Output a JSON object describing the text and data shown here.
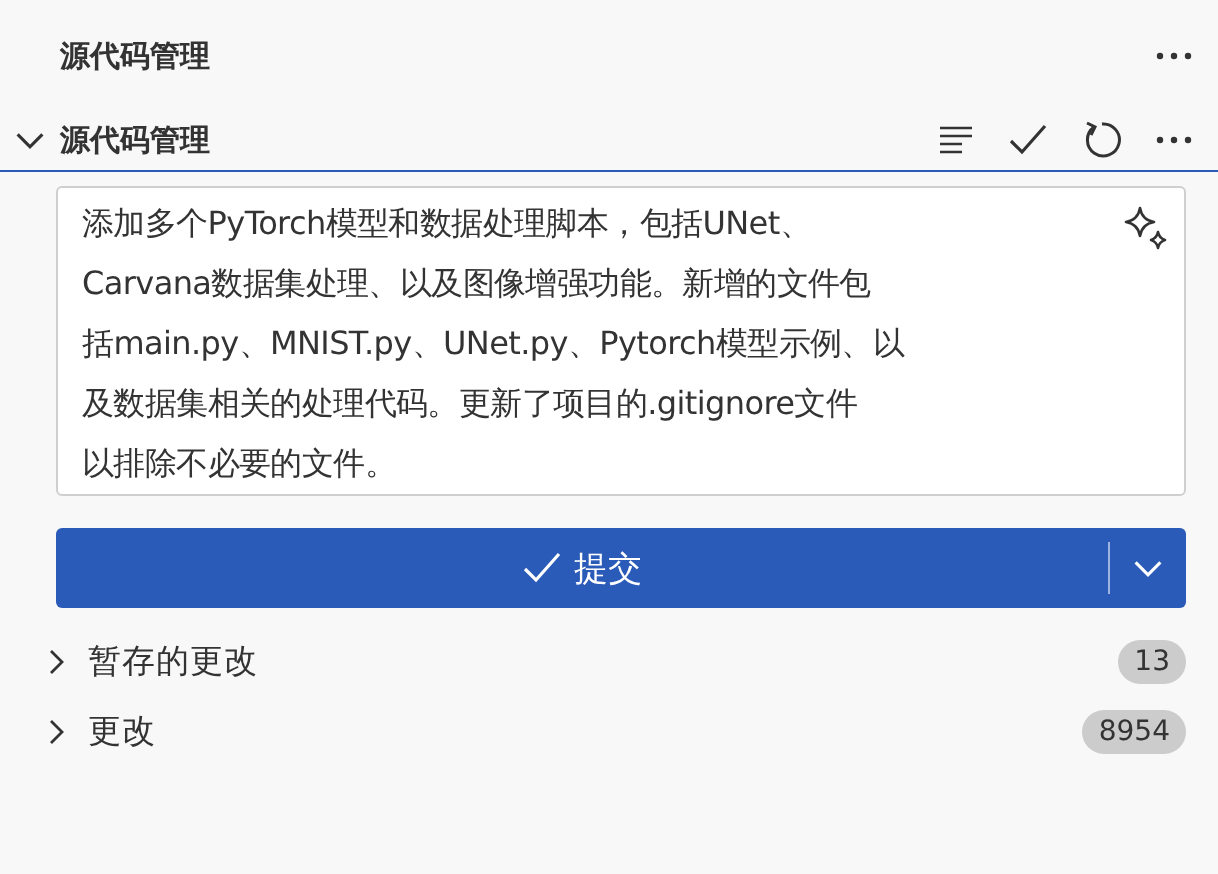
{
  "view_title": "源代码管理",
  "section": {
    "title": "源代码管理",
    "expanded": true
  },
  "commit_message": {
    "lines": [
      "添加多个PyTorch模型和数据处理脚本，包括UNet、",
      "Carvana数据集处理、以及图像增强功能。新增的文件包",
      "括main.py、MNIST.py、UNet.py、Pytorch模型示例、以",
      "及数据集相关的处理代码。更新了项目的.gitignore文件",
      "以排除不必要的文件。"
    ]
  },
  "commit_button": {
    "label": "提交"
  },
  "groups": [
    {
      "label": "暂存的更改",
      "count": "13",
      "expanded": false
    },
    {
      "label": "更改",
      "count": "8954",
      "expanded": false
    }
  ]
}
